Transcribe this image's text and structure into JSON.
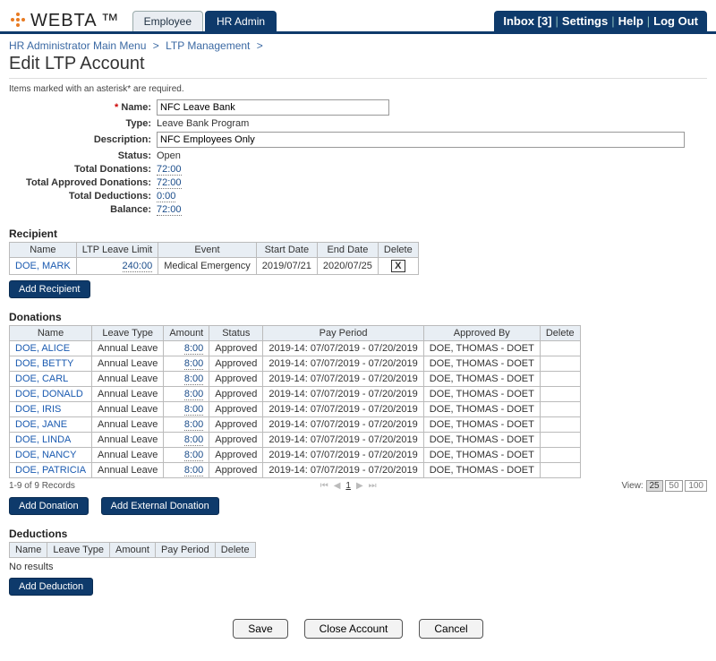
{
  "header": {
    "brand": "WEBTA",
    "tabs": [
      {
        "label": "Employee",
        "active": false
      },
      {
        "label": "HR Admin",
        "active": true
      }
    ],
    "nav": {
      "inbox_label": "Inbox [3]",
      "settings": "Settings",
      "help": "Help",
      "logout": "Log Out"
    }
  },
  "breadcrumb": {
    "items": [
      "HR Administrator Main Menu",
      "LTP Management"
    ]
  },
  "page": {
    "title": "Edit LTP Account",
    "hint": "Items marked with an asterisk* are required."
  },
  "form": {
    "name_label": "Name:",
    "name_value": "NFC Leave Bank",
    "type_label": "Type:",
    "type_value": "Leave Bank Program",
    "description_label": "Description:",
    "description_value": "NFC Employees Only",
    "status_label": "Status:",
    "status_value": "Open",
    "total_donations_label": "Total Donations:",
    "total_donations_value": "72:00",
    "total_approved_label": "Total Approved Donations:",
    "total_approved_value": "72:00",
    "total_deductions_label": "Total Deductions:",
    "total_deductions_value": "0:00",
    "balance_label": "Balance:",
    "balance_value": "72:00"
  },
  "recipient": {
    "heading": "Recipient",
    "columns": [
      "Name",
      "LTP Leave Limit",
      "Event",
      "Start Date",
      "End Date",
      "Delete"
    ],
    "rows": [
      {
        "name": "DOE, MARK",
        "limit": "240:00",
        "event": "Medical Emergency",
        "start": "2019/07/21",
        "end": "2020/07/25"
      }
    ],
    "add_button": "Add Recipient"
  },
  "donations": {
    "heading": "Donations",
    "columns": [
      "Name",
      "Leave Type",
      "Amount",
      "Status",
      "Pay Period",
      "Approved By",
      "Delete"
    ],
    "rows": [
      {
        "name": "DOE, ALICE",
        "leave_type": "Annual Leave",
        "amount": "8:00",
        "status": "Approved",
        "pp": "2019-14: 07/07/2019 - 07/20/2019",
        "approved_by": "DOE, THOMAS - DOET"
      },
      {
        "name": "DOE, BETTY",
        "leave_type": "Annual Leave",
        "amount": "8:00",
        "status": "Approved",
        "pp": "2019-14: 07/07/2019 - 07/20/2019",
        "approved_by": "DOE, THOMAS - DOET"
      },
      {
        "name": "DOE, CARL",
        "leave_type": "Annual Leave",
        "amount": "8:00",
        "status": "Approved",
        "pp": "2019-14: 07/07/2019 - 07/20/2019",
        "approved_by": "DOE, THOMAS - DOET"
      },
      {
        "name": "DOE, DONALD",
        "leave_type": "Annual Leave",
        "amount": "8:00",
        "status": "Approved",
        "pp": "2019-14: 07/07/2019 - 07/20/2019",
        "approved_by": "DOE, THOMAS - DOET"
      },
      {
        "name": "DOE, IRIS",
        "leave_type": "Annual Leave",
        "amount": "8:00",
        "status": "Approved",
        "pp": "2019-14: 07/07/2019 - 07/20/2019",
        "approved_by": "DOE, THOMAS - DOET"
      },
      {
        "name": "DOE, JANE",
        "leave_type": "Annual Leave",
        "amount": "8:00",
        "status": "Approved",
        "pp": "2019-14: 07/07/2019 - 07/20/2019",
        "approved_by": "DOE, THOMAS - DOET"
      },
      {
        "name": "DOE, LINDA",
        "leave_type": "Annual Leave",
        "amount": "8:00",
        "status": "Approved",
        "pp": "2019-14: 07/07/2019 - 07/20/2019",
        "approved_by": "DOE, THOMAS - DOET"
      },
      {
        "name": "DOE, NANCY",
        "leave_type": "Annual Leave",
        "amount": "8:00",
        "status": "Approved",
        "pp": "2019-14: 07/07/2019 - 07/20/2019",
        "approved_by": "DOE, THOMAS - DOET"
      },
      {
        "name": "DOE, PATRICIA",
        "leave_type": "Annual Leave",
        "amount": "8:00",
        "status": "Approved",
        "pp": "2019-14: 07/07/2019 - 07/20/2019",
        "approved_by": "DOE, THOMAS - DOET"
      }
    ],
    "record_count": "1-9 of 9 Records",
    "view_label": "View:",
    "view_options": [
      "25",
      "50",
      "100"
    ],
    "add_donation": "Add Donation",
    "add_external": "Add External Donation"
  },
  "deductions": {
    "heading": "Deductions",
    "columns": [
      "Name",
      "Leave Type",
      "Amount",
      "Pay Period",
      "Delete"
    ],
    "no_results": "No results",
    "add_button": "Add Deduction"
  },
  "footer": {
    "save": "Save",
    "close": "Close Account",
    "cancel": "Cancel"
  }
}
